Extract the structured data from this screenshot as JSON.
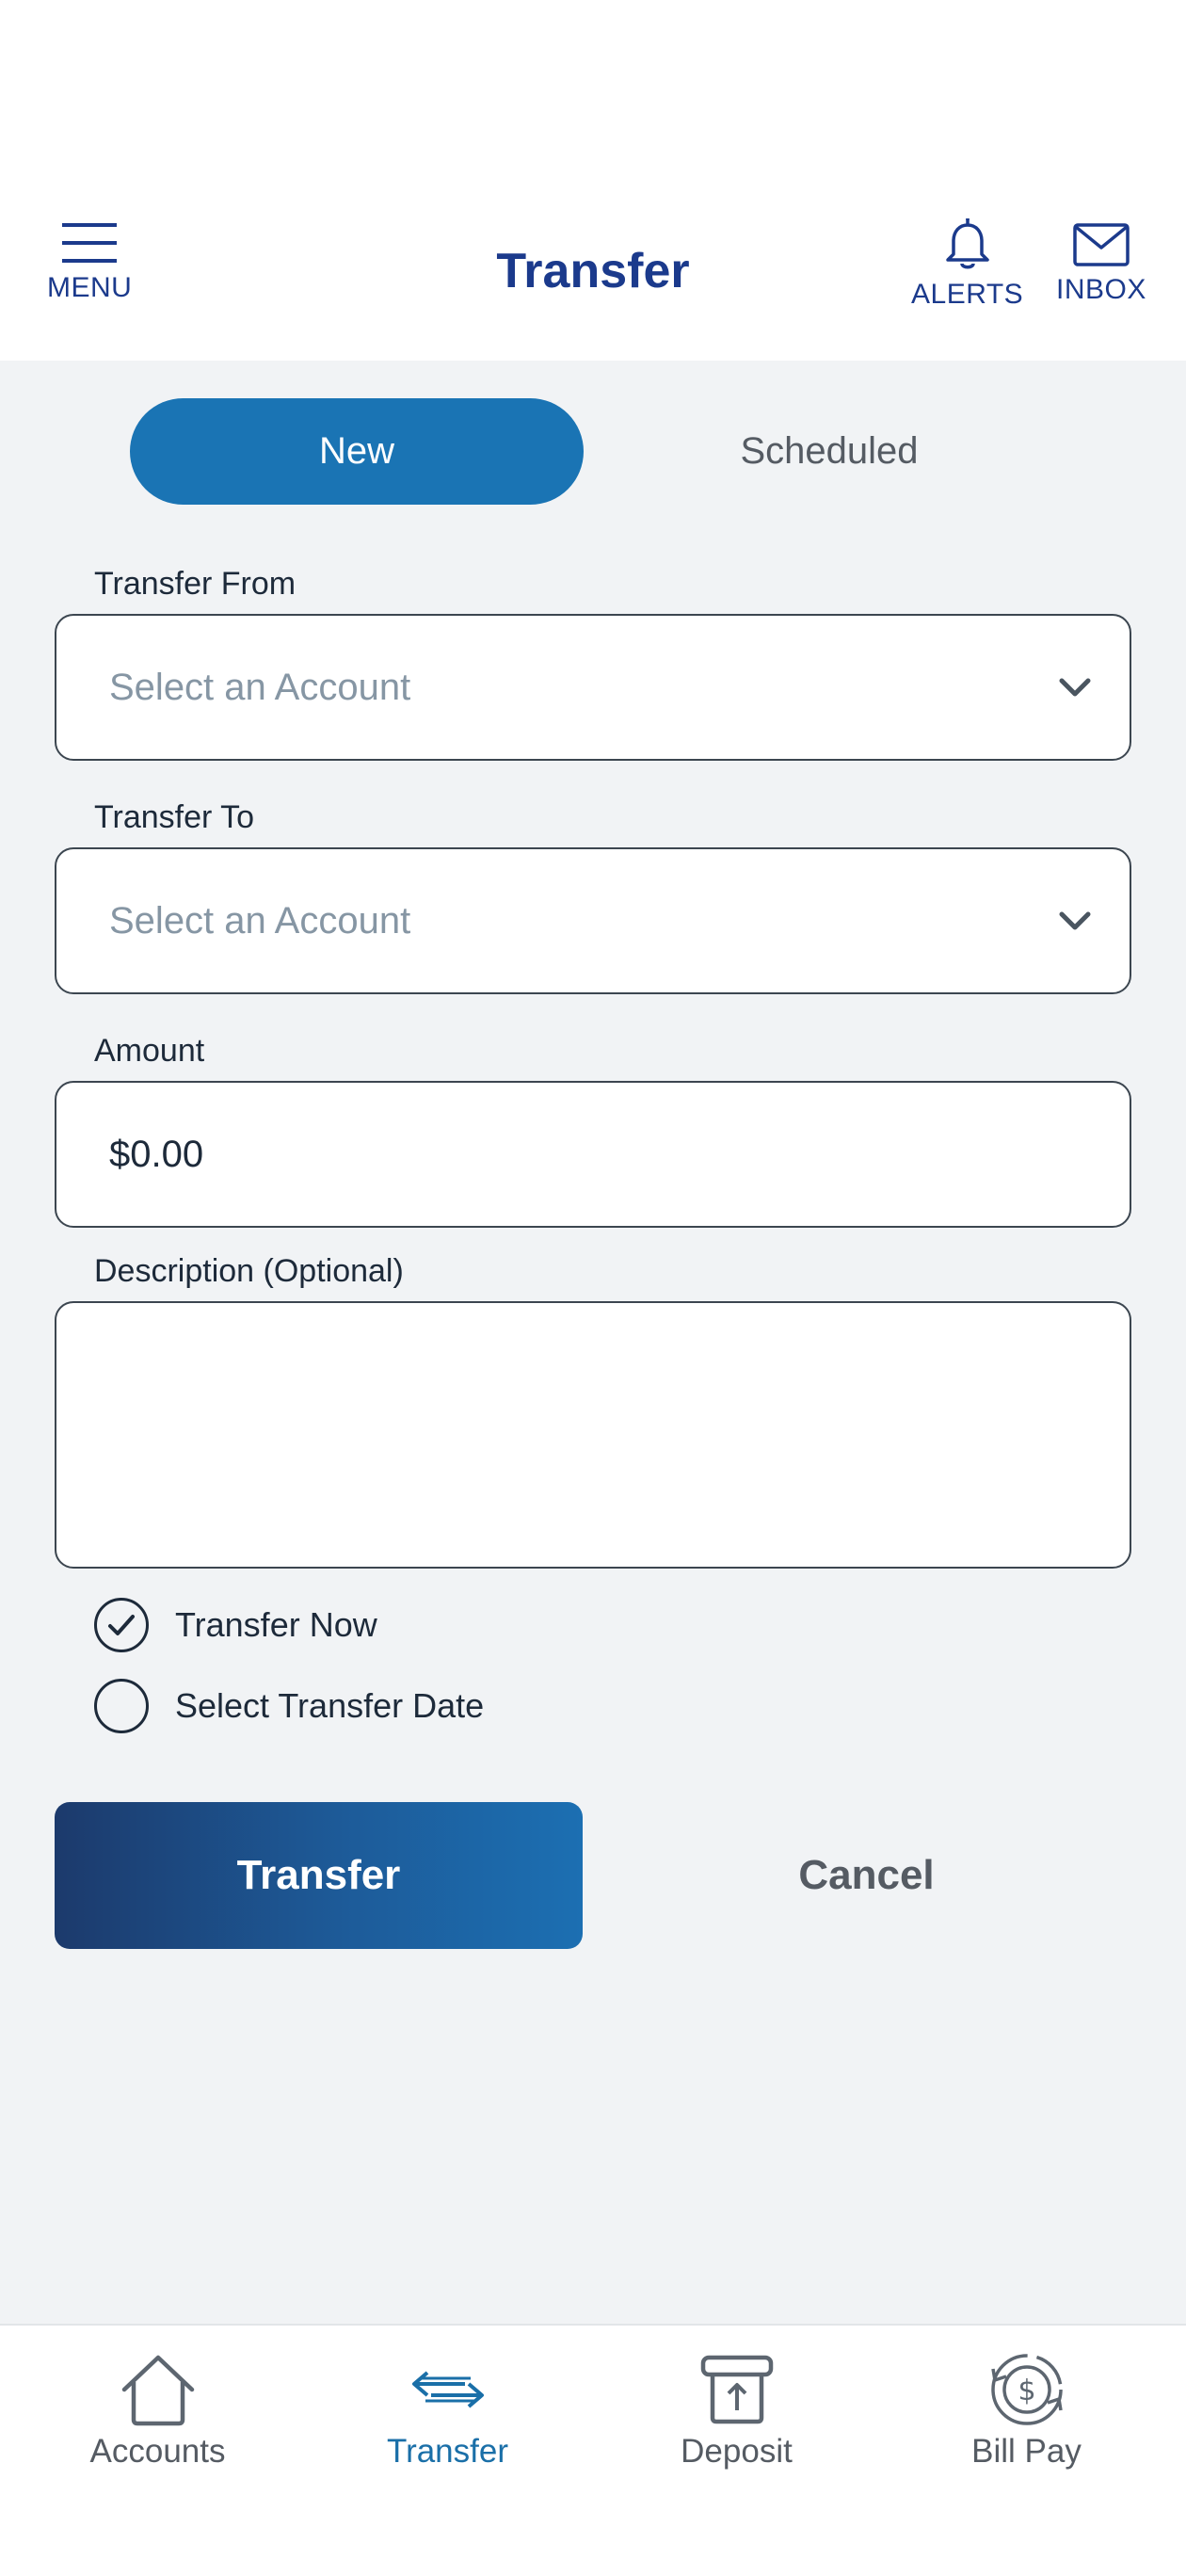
{
  "header": {
    "title": "Transfer",
    "menu_label": "MENU",
    "alerts_label": "ALERTS",
    "inbox_label": "INBOX",
    "icons": [
      "hamburger-icon",
      "bell-icon",
      "mail-icon"
    ]
  },
  "segment": {
    "new_label": "New",
    "scheduled_label": "Scheduled",
    "active": "New"
  },
  "form": {
    "from_label": "Transfer From",
    "from_placeholder": "Select an Account",
    "to_label": "Transfer To",
    "to_placeholder": "Select an Account",
    "amount_label": "Amount",
    "amount_value": "$0.00",
    "description_label": "Description (Optional)",
    "description_value": "",
    "option_now": "Transfer Now",
    "option_date": "Select Transfer Date",
    "selected_option": "Transfer Now"
  },
  "actions": {
    "transfer_label": "Transfer",
    "cancel_label": "Cancel"
  },
  "tabbar": {
    "items": [
      {
        "label": "Accounts",
        "icon": "home-icon"
      },
      {
        "label": "Transfer",
        "icon": "transfer-arrows-icon"
      },
      {
        "label": "Deposit",
        "icon": "deposit-icon"
      },
      {
        "label": "Bill Pay",
        "icon": "bill-pay-icon"
      }
    ],
    "active": "Transfer"
  },
  "colors": {
    "brand": "#1b3a8c",
    "accent": "#1a74b4",
    "background": "#f1f3f5"
  }
}
